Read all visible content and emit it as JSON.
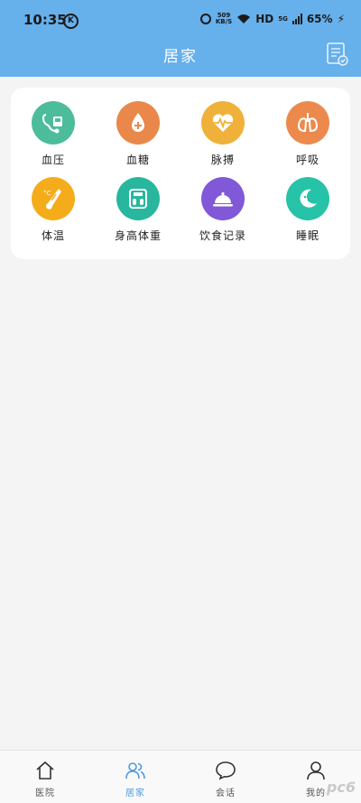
{
  "status_bar": {
    "time": "10:35",
    "k_badge": "K",
    "net_speed_value": "509",
    "net_speed_unit": "KB/S",
    "hd": "HD",
    "network": "5G",
    "battery": "65%"
  },
  "header": {
    "title": "居家",
    "bg_color": "#66b0ec"
  },
  "tiles": [
    {
      "label": "血压",
      "icon": "blood-pressure-icon",
      "color": "#4dbc9b"
    },
    {
      "label": "血糖",
      "icon": "blood-sugar-icon",
      "color": "#e9884a"
    },
    {
      "label": "脉搏",
      "icon": "pulse-heart-icon",
      "color": "#f0b13a"
    },
    {
      "label": "呼吸",
      "icon": "lungs-icon",
      "color": "#ec8a4e"
    },
    {
      "label": "体温",
      "icon": "thermometer-icon",
      "color": "#f4ac1a"
    },
    {
      "label": "身高体重",
      "icon": "scale-icon",
      "color": "#28b79e"
    },
    {
      "label": "饮食记录",
      "icon": "food-cloche-icon",
      "color": "#8058d8"
    },
    {
      "label": "睡眠",
      "icon": "moon-icon",
      "color": "#26c3a8"
    }
  ],
  "bottom_nav": [
    {
      "label": "医院",
      "icon": "home-icon"
    },
    {
      "label": "居家",
      "icon": "users-icon",
      "active": true
    },
    {
      "label": "会话",
      "icon": "chat-bubble-icon"
    },
    {
      "label": "我的",
      "icon": "profile-icon"
    }
  ],
  "watermark": "pc6"
}
